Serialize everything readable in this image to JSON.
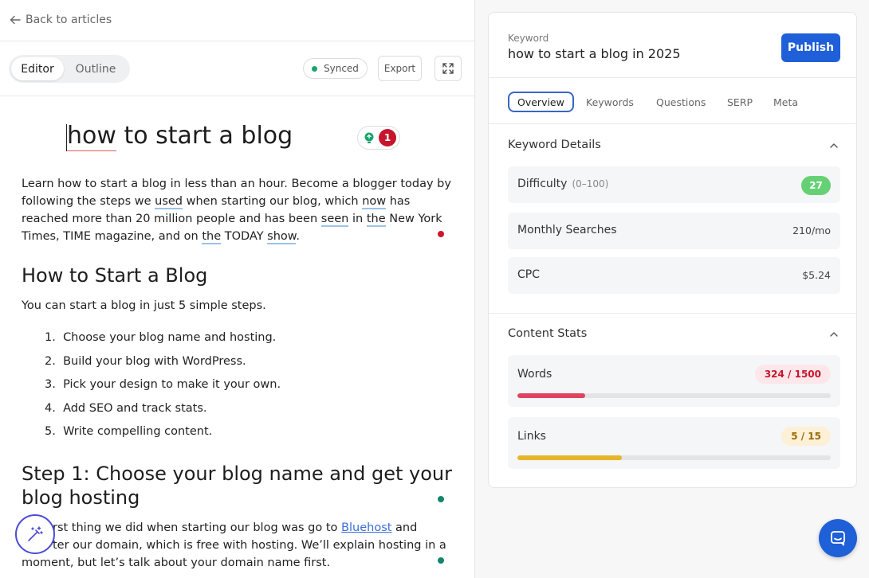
{
  "nav": {
    "back_label": "Back to articles"
  },
  "toolbar": {
    "tabs": [
      {
        "label": "Editor"
      },
      {
        "label": "Outline"
      }
    ],
    "sync_status": "Synced",
    "export_label": "Export",
    "status_color": "#18a56b"
  },
  "editor": {
    "title": "how to start a blog",
    "suggestion_count": "1",
    "intro_parts": [
      "Learn how to start a blog in less than an hour. Become a blogger today by following the steps we ",
      "used",
      " when starting our blog, which ",
      "now",
      " has reached more than 20 million people and has been ",
      "seen",
      " in ",
      "the",
      " New York Times, TIME magazine, and on ",
      "the",
      " TODAY ",
      "show",
      "."
    ],
    "heading_1": "How to Start a Blog",
    "para_1": "You can start a blog in just 5 simple steps.",
    "steps": [
      {
        "num": "1.",
        "text": "Choose your blog name and hosting."
      },
      {
        "num": "2.",
        "text": "Build your blog with WordPress."
      },
      {
        "num": "3.",
        "text": "Pick your design to make it your own."
      },
      {
        "num": "4.",
        "text": "Add SEO and track stats."
      },
      {
        "num": "5.",
        "text": "Write compelling content."
      }
    ],
    "heading_2": "Step 1: Choose your blog name and get your blog hosting",
    "para_2_before": "rst thing we did when starting our blog was go to ",
    "para_2_link": "Bluehost",
    "para_2_after": " and",
    "para_2_line2": "ter our domain, which is free with hosting. We’ll explain hosting in a",
    "para_2_line3": "moment, but let’s talk about your domain name first."
  },
  "sidebar": {
    "keyword_label": "Keyword",
    "keyword_value": "how to start a blog in 2025",
    "publish_label": "Publish",
    "tabs": [
      {
        "label": "Overview"
      },
      {
        "label": "Keywords"
      },
      {
        "label": "Questions"
      },
      {
        "label": "SERP"
      },
      {
        "label": "Meta"
      }
    ],
    "keyword_details": {
      "title": "Keyword Details",
      "difficulty_label": "Difficulty",
      "difficulty_range": "(0–100)",
      "difficulty_value": "27",
      "monthly_label": "Monthly Searches",
      "monthly_value": "210/mo",
      "cpc_label": "CPC",
      "cpc_value": "$5.24"
    },
    "content_stats": {
      "title": "Content Stats",
      "words_label": "Words",
      "words_value": "324 / 1500",
      "words_progress": 0.216,
      "links_label": "Links",
      "links_value": "5 / 15",
      "links_progress": 0.333
    }
  },
  "colors": {
    "accent": "#1f5fd8",
    "words_bar": "#e0435f",
    "links_bar": "#e6b52a",
    "difficulty_pill": "#66d174",
    "suggestion_badge": "#c5162e"
  }
}
